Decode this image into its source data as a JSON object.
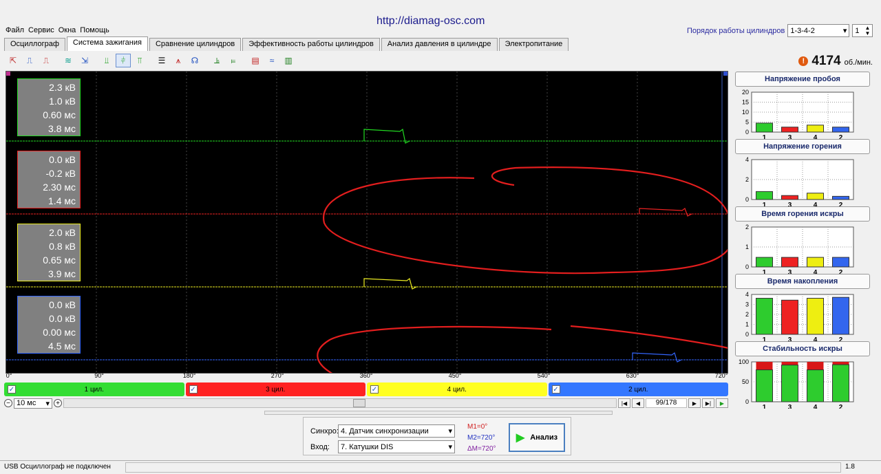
{
  "site_url": "http://diamag-osc.com",
  "menu": [
    "Файл",
    "Сервис",
    "Окна",
    "Помощь"
  ],
  "firing_order": {
    "label": "Порядок работы цилиндров",
    "value": "1-3-4-2",
    "spin": "1"
  },
  "tabs": [
    "Осциллограф",
    "Система зажигания",
    "Сравнение цилиндров",
    "Эффективность работы цилиндров",
    "Анализ давления в цилиндре",
    "Электропитание"
  ],
  "active_tab": 1,
  "rpm": {
    "value": "4174",
    "unit": "об./мин."
  },
  "scope": {
    "marker_left": "1",
    "marker_right": "2",
    "traces": [
      {
        "color": "#22dd22",
        "values": [
          "2.3 кВ",
          "1.0 кВ",
          "0.60 мс",
          "3.8 мс"
        ]
      },
      {
        "color": "#ee2222",
        "values": [
          "0.0 кВ",
          "-0.2 кВ",
          "2.30 мс",
          "1.4 мс"
        ]
      },
      {
        "color": "#eeee22",
        "values": [
          "2.0 кВ",
          "0.8 кВ",
          "0.65 мс",
          "3.9 мс"
        ]
      },
      {
        "color": "#3366ff",
        "values": [
          "0.0 кВ",
          "0.0 кВ",
          "0.00 мс",
          "4.5 мс"
        ]
      }
    ],
    "degree_ticks": [
      "0°",
      "90°",
      "180°",
      "270°",
      "360°",
      "450°",
      "540°",
      "630°",
      "720°"
    ]
  },
  "channels": [
    {
      "label": "1 цил.",
      "color": "#33dd33"
    },
    {
      "label": "3 цил.",
      "color": "#ff2222"
    },
    {
      "label": "4 цил.",
      "color": "#ffff22"
    },
    {
      "label": "2 цил.",
      "color": "#3377ff"
    }
  ],
  "timebase": "10 мс",
  "page": "99/178",
  "colors": {
    "green": "#2ecc2e",
    "red": "#ee2222",
    "yellow": "#eeee11",
    "blue": "#3366ee"
  },
  "panels": [
    {
      "title": "Напряжение пробоя",
      "yticks": [
        "20",
        "15",
        "10",
        "5",
        "0"
      ],
      "ymax": 20,
      "cats": [
        "1",
        "3",
        "4",
        "2"
      ],
      "values": [
        4.5,
        2.5,
        3.5,
        2.5
      ]
    },
    {
      "title": "Напряжение горения",
      "yticks": [
        "4",
        "2",
        "0"
      ],
      "ymax": 5,
      "cats": [
        "1",
        "3",
        "4",
        "2"
      ],
      "values": [
        1.0,
        0.5,
        0.8,
        0.4
      ]
    },
    {
      "title": "Время горения искры",
      "yticks": [
        "2",
        "1",
        "0"
      ],
      "ymax": 2.5,
      "cats": [
        "1",
        "3",
        "4",
        "2"
      ],
      "values": [
        0.6,
        0.6,
        0.6,
        0.6
      ]
    },
    {
      "title": "Время накопления",
      "yticks": [
        "4",
        "3",
        "2",
        "1",
        "0"
      ],
      "ymax": 4.2,
      "cats": [
        "1",
        "3",
        "4",
        "2"
      ],
      "values": [
        3.8,
        3.6,
        3.8,
        3.9
      ]
    },
    {
      "title": "Стабильность искры",
      "yticks": [
        "100",
        "50",
        "0"
      ],
      "ymax": 100,
      "cats": [
        "1",
        "3",
        "4",
        "2"
      ],
      "values": [
        80,
        92,
        80,
        93
      ],
      "stacked": true
    }
  ],
  "sync": {
    "sync_label": "Синхро:",
    "sync_value": "4.  Датчик синхронизации",
    "input_label": "Вход:",
    "input_value": "7.  Катушки DIS",
    "m1": "M1=0°",
    "m2": "M2=720°",
    "dm": "ΔM=720°",
    "analyze": "Анализ"
  },
  "status": {
    "left": "USB Осциллограф не подключен",
    "right": "1.8"
  }
}
